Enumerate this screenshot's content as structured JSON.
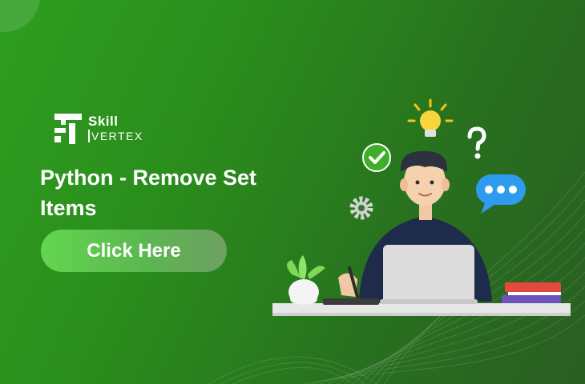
{
  "logo": {
    "line1": "Skill",
    "line2": "VERTEX"
  },
  "heading": "Python - Remove Set Items",
  "cta": {
    "label": "Click Here"
  },
  "illustration": {
    "icons": [
      "lightbulb-icon",
      "checkmark-icon",
      "question-mark-icon",
      "gear-icon",
      "chat-bubble-icon"
    ]
  },
  "colors": {
    "background_start": "#2e9e1f",
    "background_end": "#2a5e22",
    "button_start": "#63d64f",
    "button_end": "#6f9f63",
    "text": "#ffffff"
  }
}
